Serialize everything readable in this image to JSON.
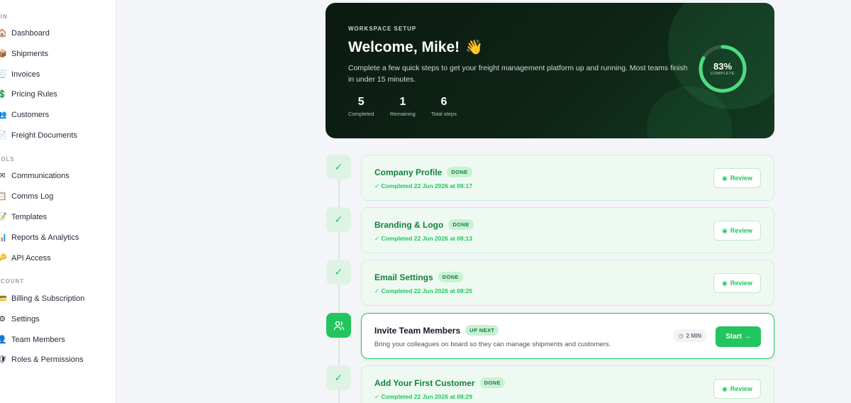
{
  "sidebar": {
    "sections": [
      {
        "label": "AIN"
      },
      {
        "label": "OOLS"
      },
      {
        "label": "CCOUNT"
      }
    ],
    "items": [
      {
        "label": "Dashboard",
        "icon": "🏠"
      },
      {
        "label": "Shipments",
        "icon": "📦"
      },
      {
        "label": "Invoices",
        "icon": "🧾"
      },
      {
        "label": "Pricing Rules",
        "icon": "💲"
      },
      {
        "label": "Customers",
        "icon": "👥"
      },
      {
        "label": "Freight Documents",
        "icon": "📄"
      },
      {
        "label": "Communications",
        "icon": "✉"
      },
      {
        "label": "Comms Log",
        "icon": "📋"
      },
      {
        "label": "Templates",
        "icon": "📝"
      },
      {
        "label": "Reports & Analytics",
        "icon": "📊"
      },
      {
        "label": "API Access",
        "icon": "🔑"
      },
      {
        "label": "Billing & Subscription",
        "icon": "💳"
      },
      {
        "label": "Settings",
        "icon": "⚙"
      },
      {
        "label": "Team Members",
        "icon": "👤"
      },
      {
        "label": "Roles & Permissions",
        "icon": "🛡"
      }
    ]
  },
  "hero": {
    "eyebrow": "WORKSPACE SETUP",
    "title": "Welcome, Mike!",
    "wave": "👋",
    "description": "Complete a few quick steps to get your freight management platform up and running. Most teams finish in under 15 minutes.",
    "stats": [
      {
        "value": "5",
        "label": "Completed"
      },
      {
        "value": "1",
        "label": "Remaining"
      },
      {
        "value": "6",
        "label": "Total steps"
      }
    ],
    "progress_percent": 83,
    "progress_text": "83%",
    "progress_label": "COMPLETE"
  },
  "steps": [
    {
      "title": "Company Profile",
      "badge": "DONE",
      "subtitle": "✓ Completed 22 Jun 2026 at 08:17",
      "action": "Review",
      "status": "done"
    },
    {
      "title": "Branding & Logo",
      "badge": "DONE",
      "subtitle": "✓ Completed 22 Jun 2026 at 08:13",
      "action": "Review",
      "status": "done"
    },
    {
      "title": "Email Settings",
      "badge": "DONE",
      "subtitle": "✓ Completed 22 Jun 2026 at 08:25",
      "action": "Review",
      "status": "done"
    },
    {
      "title": "Invite Team Members",
      "badge": "UP NEXT",
      "subtitle": "Bring your colleagues on board so they can manage shipments and customers.",
      "action": "Start →",
      "time": "2 MIN",
      "status": "active"
    },
    {
      "title": "Add Your First Customer",
      "badge": "DONE",
      "subtitle": "✓ Completed 22 Jun 2026 at 08:29",
      "action": "Review",
      "status": "done"
    }
  ],
  "colors": {
    "accent": "#22c55e",
    "hero_bg": "#0c1a12"
  }
}
